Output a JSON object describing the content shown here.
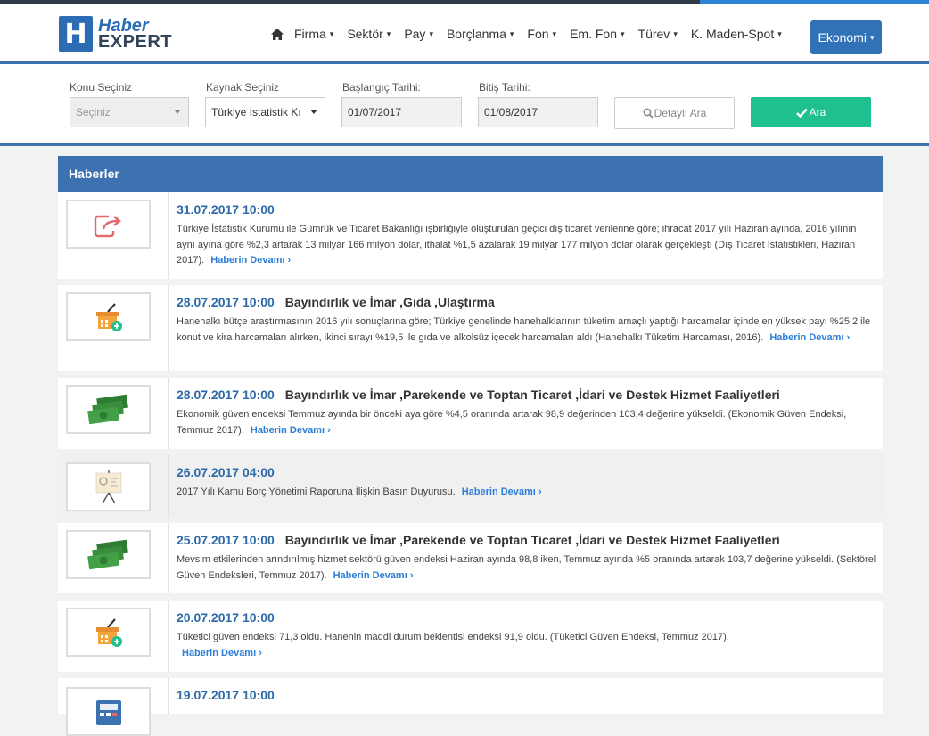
{
  "brand": {
    "line1": "Haber",
    "line2": "EXPERT",
    "badge": "H",
    "color": "#2b6cb5"
  },
  "nav": {
    "home_icon": "home-icon",
    "items": [
      "Firma",
      "Sektör",
      "Pay",
      "Borçlanma",
      "Fon",
      "Em. Fon",
      "Türev",
      "K. Maden-Spot"
    ],
    "active": "Ekonomi",
    "chevron": "▾"
  },
  "filters": {
    "konu_label": "Konu Seçiniz",
    "konu_value": "Seçiniz",
    "kaynak_label": "Kaynak Seçiniz",
    "kaynak_value": "Türkiye İstatistik Kı",
    "baslangic_label": "Başlangıç Tarihi:",
    "baslangic_value": "01/07/2017",
    "bitis_label": "Bitiş Tarihi:",
    "bitis_value": "01/08/2017",
    "detail_button": "Detaylı Ara",
    "search_button": "Ara",
    "search_color": "#1fbf8f"
  },
  "panel": {
    "title": "Haberler"
  },
  "more_label": "Haberin Devamı",
  "news": [
    {
      "date": "31.07.2017 10:00",
      "category": "",
      "body": "Türkiye İstatistik Kurumu ile Gümrük ve Ticaret Bakanlığı işbirliğiyle oluşturulan geçici dış ticaret verilerine göre; ihracat 2017 yılı Haziran ayında, 2016 yılının aynı ayına göre %2,3  artarak 13 milyar 166 milyon dolar, ithalat %1,5 azalarak 19 milyar 177 milyon dolar olarak gerçekleşti (Dış Ticaret İstatistikleri, Haziran 2017).",
      "icon": "share-arrow-icon"
    },
    {
      "date": "28.07.2017 10:00",
      "category": "Bayındırlık ve İmar ,Gıda ,Ulaştırma",
      "body": "Hanehalkı bütçe araştırmasının 2016 yılı sonuçlarına göre; Türkiye genelinde hanehalklarının tüketim amaçlı yaptığı harcamalar içinde en yüksek payı %25,2 ile konut ve kira harcamaları alırken, ikinci sırayı %19,5 ile gıda ve alkolsüz içecek harcamaları aldı (Hanehalkı Tüketim Harcaması, 2016).",
      "icon": "shopping-basket-icon"
    },
    {
      "date": "28.07.2017 10:00",
      "category": "Bayındırlık ve İmar ,Parekende ve Toptan Ticaret ,İdari ve Destek Hizmet Faaliyetleri",
      "body": "Ekonomik güven endeksi Temmuz ayında bir önceki aya göre %4,5 oranında artarak 98,9 değerinden 103,4 değerine yükseldi. (Ekonomik Güven Endeksi, Temmuz 2017).",
      "icon": "banknotes-icon"
    },
    {
      "date": "26.07.2017 04:00",
      "category": "",
      "body": "2017 Yılı Kamu Borç Yönetimi Raporuna İlişkin Basın Duyurusu.",
      "icon": "presentation-board-icon"
    },
    {
      "date": "25.07.2017 10:00",
      "category": "Bayındırlık ve İmar ,Parekende ve Toptan Ticaret ,İdari ve Destek Hizmet Faaliyetleri",
      "body": "Mevsim etkilerinden arındırılmış hizmet sektörü güven endeksi Haziran ayında 98,8 iken, Temmuz ayında %5 oranında artarak 103,7 değerine yükseldi. (Sektörel Güven Endeksleri, Temmuz 2017).",
      "icon": "banknotes-icon"
    },
    {
      "date": "20.07.2017 10:00",
      "category": "",
      "body": "Tüketici güven endeksi 71,3 oldu. Hanenin maddi durum beklentisi endeksi 91,9 oldu. (Tüketici Güven Endeksi, Temmuz 2017).",
      "icon": "shopping-basket-icon"
    },
    {
      "date": "19.07.2017 10:00",
      "category": "",
      "body": "",
      "icon": "calculator-icon"
    }
  ]
}
